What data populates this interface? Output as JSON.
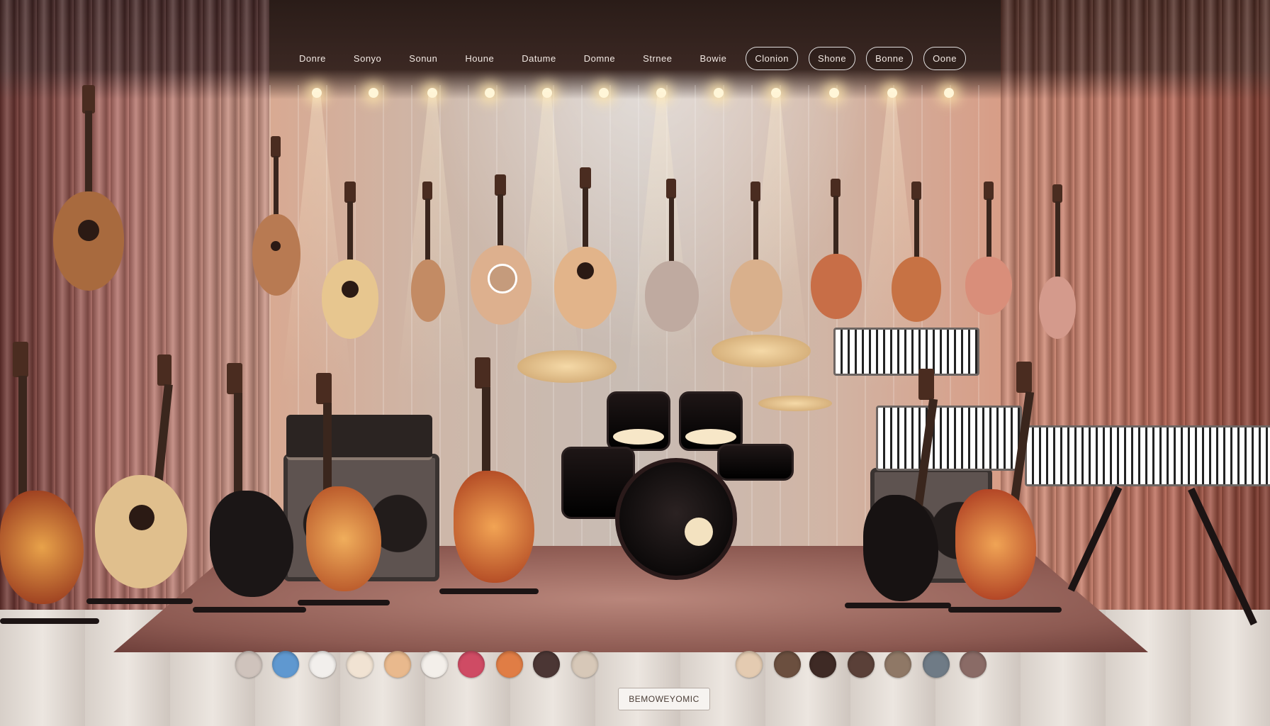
{
  "nav": {
    "items": [
      {
        "label": "Donre",
        "outlined": false
      },
      {
        "label": "Sonyo",
        "outlined": false
      },
      {
        "label": "Sonun",
        "outlined": false
      },
      {
        "label": "Houne",
        "outlined": false
      },
      {
        "label": "Datume",
        "outlined": false
      },
      {
        "label": "Domne",
        "outlined": false
      },
      {
        "label": "Strnee",
        "outlined": false
      },
      {
        "label": "Bowie",
        "outlined": false
      },
      {
        "label": "Clonion",
        "outlined": false
      },
      {
        "label": "Shone",
        "outlined": true
      },
      {
        "label": "Bonne",
        "outlined": true
      },
      {
        "label": "Oone",
        "outlined": true
      }
    ]
  },
  "swatches": [
    {
      "color": "#cfc3bc"
    },
    {
      "color": "#5f98d0"
    },
    {
      "color": "#f2efec"
    },
    {
      "color": "#f1e3d3"
    },
    {
      "color": "#e9b98d"
    },
    {
      "color": "#f3efea"
    },
    {
      "color": "#cf4b64"
    },
    {
      "color": "#e07d45"
    },
    {
      "color": "#4b3634"
    },
    {
      "color": "#d7c8b8"
    },
    {
      "color": "#e4cbb1"
    },
    {
      "color": "#6b4f3f"
    },
    {
      "color": "#3e2a25"
    },
    {
      "color": "#5a4038"
    },
    {
      "color": "#8f7866"
    },
    {
      "color": "#6f7b86"
    },
    {
      "color": "#8a6b66"
    }
  ],
  "bottom_label": "BEMOWEYOMIC",
  "icons": {
    "acoustic": "acoustic-guitar-icon",
    "electric": "electric-guitar-icon",
    "violin": "violin-icon",
    "drums": "drum-kit-icon",
    "keys": "keyboard-icon",
    "amp": "amplifier-icon"
  }
}
